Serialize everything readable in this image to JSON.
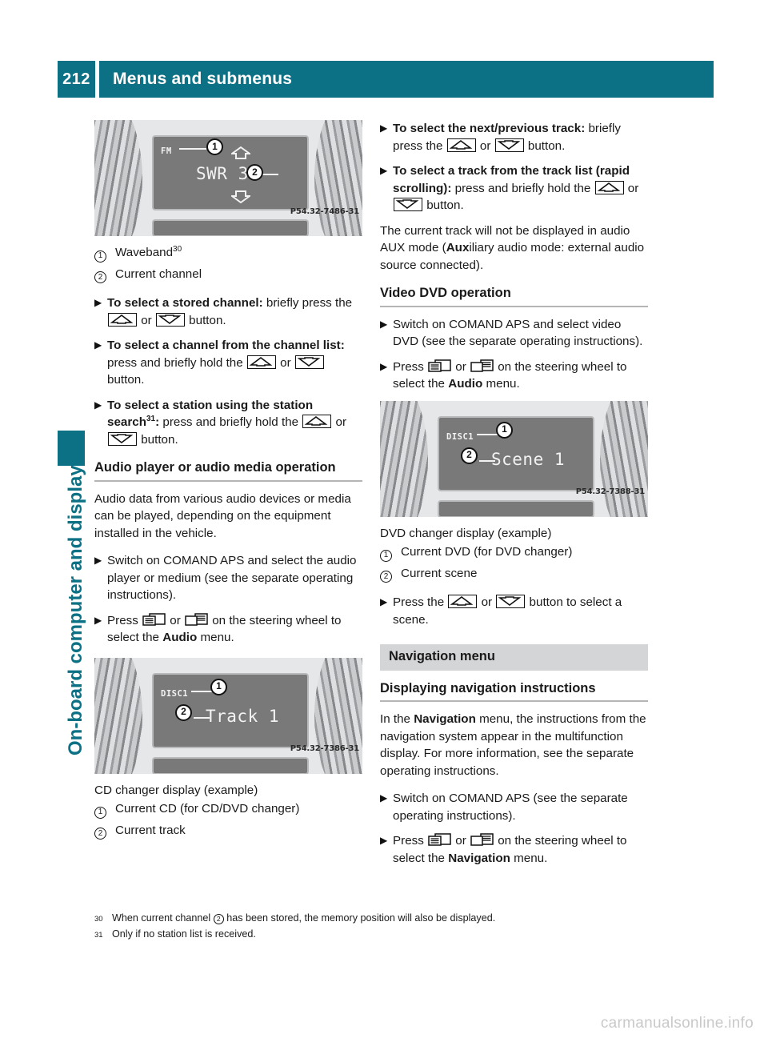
{
  "header": {
    "page_number": "212",
    "title": "Menus and submenus"
  },
  "side_tab": {
    "label": "On-board computer and displays",
    "accent_color": "#0d7186"
  },
  "left_column": {
    "figure_radio": {
      "waveband_text": "FM",
      "channel_text": "SWR 3",
      "callout_1": "1",
      "callout_2": "2",
      "image_code": "P54.32-7486-31"
    },
    "legend_radio": [
      {
        "num": "1",
        "text": "Waveband",
        "footnote": "30"
      },
      {
        "num": "2",
        "text": "Current channel",
        "footnote": ""
      }
    ],
    "bullets_radio": [
      {
        "bold_lead": "To select a stored channel:",
        "rest_a": " briefly press the ",
        "key_a": "arrow-up-key",
        "mid": " or ",
        "key_b": "arrow-down-key",
        "rest_b": " button."
      },
      {
        "bold_lead": "To select a channel from the channel list:",
        "rest_a": " press and briefly hold the ",
        "key_a": "arrow-up-key",
        "mid": " or ",
        "key_b": "arrow-down-key",
        "rest_b": " button."
      },
      {
        "bold_lead": "To select a station using the station search",
        "footnote": "31",
        "bold_tail": ":",
        "rest_a": " press and briefly hold the ",
        "key_a": "arrow-up-key",
        "mid": " or ",
        "key_b": "arrow-down-key",
        "rest_b": " button."
      }
    ],
    "audio_heading": "Audio player or audio media operation",
    "audio_intro": "Audio data from various audio devices or media can be played, depending on the equipment installed in the vehicle.",
    "audio_bullets": [
      {
        "text": "Switch on COMAND APS and select the audio player or medium (see the separate operating instructions)."
      },
      {
        "lead": "Press ",
        "key_a": "window-left-key",
        "mid": " or ",
        "key_b": "window-right-key",
        "rest": " on the steering wheel to select the ",
        "bold_word": "Audio",
        "tail": " menu."
      }
    ],
    "figure_cd": {
      "disc_text": "DISC1",
      "track_text": "Track 1",
      "callout_1": "1",
      "callout_2": "2",
      "image_code": "P54.32-7386-31"
    },
    "caption_cd": "CD changer display (example)",
    "legend_cd": [
      {
        "num": "1",
        "text": "Current CD (for CD/DVD changer)"
      },
      {
        "num": "2",
        "text": "Current track"
      }
    ]
  },
  "right_column": {
    "bullets_track": [
      {
        "bold_lead": "To select the next/previous track:",
        "rest_a": " briefly press the ",
        "key_a": "arrow-up-key",
        "mid": " or ",
        "key_b": "arrow-down-key",
        "rest_b": " button."
      },
      {
        "bold_lead": "To select a track from the track list (rapid scrolling):",
        "rest_a": " press and briefly hold the ",
        "key_a": "arrow-up-key",
        "mid": " or ",
        "key_b": "arrow-down-key",
        "rest_b": " button."
      }
    ],
    "aux_note_a": "The current track will not be displayed in audio AUX mode (",
    "aux_note_bold": "Aux",
    "aux_note_b": "iliary audio mode: external audio source connected).",
    "video_heading": "Video DVD operation",
    "video_bullets": [
      {
        "text": "Switch on COMAND APS and select video DVD (see the separate operating instructions)."
      },
      {
        "lead": "Press ",
        "key_a": "window-left-key",
        "mid": " or ",
        "key_b": "window-right-key",
        "rest": " on the steering wheel to select the ",
        "bold_word": "Audio",
        "tail": " menu."
      }
    ],
    "figure_dvd": {
      "disc_text": "DISC1",
      "scene_text": "Scene 1",
      "callout_1": "1",
      "callout_2": "2",
      "image_code": "P54.32-7388-31"
    },
    "caption_dvd": "DVD changer display (example)",
    "legend_dvd": [
      {
        "num": "1",
        "text": "Current DVD (for DVD changer)"
      },
      {
        "num": "2",
        "text": "Current scene"
      }
    ],
    "scene_bullet": {
      "lead": "Press the ",
      "key_a": "arrow-up-key",
      "mid": " or ",
      "key_b": "arrow-down-key",
      "rest": " button to select a scene."
    },
    "nav_band_heading": "Navigation menu",
    "nav_subheading": "Displaying navigation instructions",
    "nav_intro_a": "In the ",
    "nav_intro_bold": "Navigation",
    "nav_intro_b": " menu, the instructions from the navigation system appear in the multifunction display. For more information, see the separate operating instructions.",
    "nav_bullets": [
      {
        "text": "Switch on COMAND APS (see the separate operating instructions)."
      },
      {
        "lead": "Press ",
        "key_a": "window-left-key",
        "mid": " or ",
        "key_b": "window-right-key",
        "rest": " on the steering wheel to select the ",
        "bold_word": "Navigation",
        "tail": " menu."
      }
    ]
  },
  "footnotes": [
    {
      "num": "30",
      "text_a": "When current channel ",
      "symbol": "2",
      "text_b": " has been stored, the memory position will also be displayed."
    },
    {
      "num": "31",
      "text_a": "Only if no station list is received.",
      "symbol": "",
      "text_b": ""
    }
  ],
  "watermark": "carmanualsonline.info"
}
